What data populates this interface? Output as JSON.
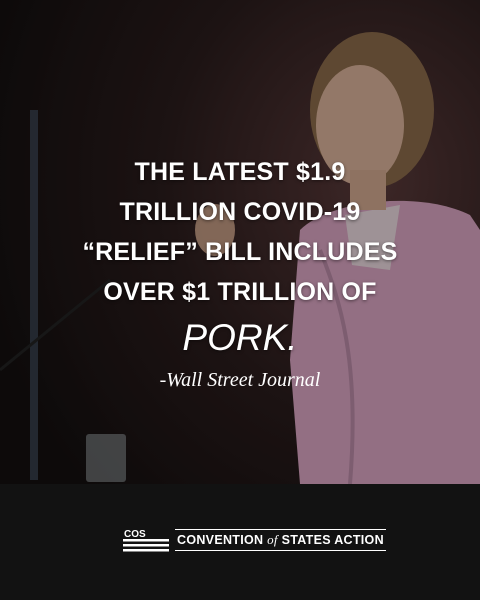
{
  "quote": {
    "lines": [
      "THE LATEST $1.9",
      "TRILLION COVID-19",
      "“RELIEF” BILL INCLUDES",
      "OVER $1 TRILLION OF"
    ],
    "emphasis": "PORK.",
    "attribution": "-Wall Street Journal"
  },
  "logo": {
    "mark_text": "COS",
    "name_before": "CONVENTION",
    "name_of": "of",
    "name_after": "STATES ACTION"
  },
  "colors": {
    "background": "#141010",
    "footer": "#121212",
    "jacket": "#d9a4c2",
    "text": "#ffffff"
  }
}
